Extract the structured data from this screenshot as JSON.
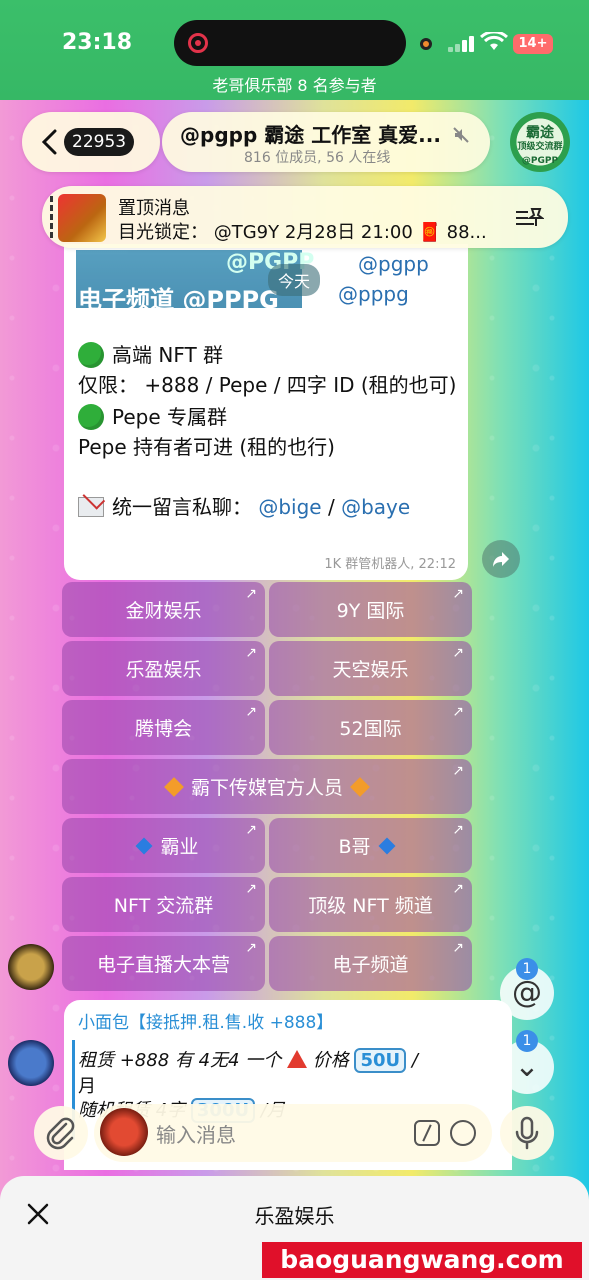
{
  "status_bar": {
    "time": "23:18",
    "battery": "14+"
  },
  "group_subtitle": "老哥俱乐部 8 名参与者",
  "header": {
    "unread_count": "22953",
    "title": "@pgpp 霸途 工作室 真爱...",
    "members": "816 位成员, 56 人在线",
    "avatar_text_1": "霸途",
    "avatar_text_2": "顶级交流群",
    "avatar_text_3": "@PGPP"
  },
  "pinned": {
    "label": "置顶消息",
    "text": "目光锁定： @TG9Y 2月28日 21:00 🧧 88..."
  },
  "message": {
    "banner_top": "@PGPP",
    "banner_main": "电子频道 @PPPG",
    "date_chip": "今天",
    "mention_1": "@pgpp",
    "mention_2": "@pppg",
    "line_1": "高端 NFT 群",
    "line_2": "仅限： +888 / Pepe / 四字 ID (租的也可)",
    "line_3": "Pepe 专属群",
    "line_4": "Pepe 持有者可进 (租的也行)",
    "line_5_prefix": "统一留言私聊： ",
    "line_5_link1": "@bige",
    "line_5_sep": " / ",
    "line_5_link2": "@baye",
    "meta": "1K  群管机器人, 22:12"
  },
  "keyboard": {
    "rows": [
      [
        "金财娱乐",
        "9Y 国际"
      ],
      [
        "乐盈娱乐",
        "天空娱乐"
      ],
      [
        "腾博会",
        "52国际"
      ],
      [
        "霸下传媒官方人员"
      ],
      [
        "霸业",
        "B哥"
      ],
      [
        "NFT 交流群",
        "顶级 NFT 频道"
      ],
      [
        "电子直播大本营",
        "电子频道"
      ]
    ],
    "arrow": "↗"
  },
  "floating": {
    "mention_badge": "1",
    "mention_symbol": "@",
    "down_badge": "1",
    "down_symbol": "⌄"
  },
  "message2": {
    "sender": "小面包【接抵押.租.售.收 +888】",
    "line_1_a": "租赁 +888 有 4无4 一个",
    "line_1_b": "价格 ",
    "line_1_price": "50U",
    "line_1_c": "/",
    "line_1_d": "月",
    "line_2_a": "随机租赁 4字 ",
    "line_2_price": "300U",
    "line_2_c": "/月"
  },
  "input": {
    "placeholder": "输入消息"
  },
  "sheet": {
    "title": "乐盈娱乐"
  },
  "watermark": "baoguangwang.com"
}
